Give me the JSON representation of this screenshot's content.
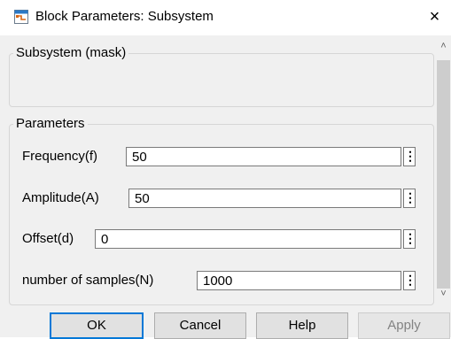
{
  "window": {
    "title": "Block Parameters: Subsystem",
    "icon": "simulink-block-icon",
    "close_label": "×"
  },
  "mask_group": {
    "legend": "Subsystem (mask)"
  },
  "parameters": {
    "legend": "Parameters",
    "rows": [
      {
        "label": "Frequency(f)",
        "value": "50"
      },
      {
        "label": "Amplitude(A)",
        "value": "50"
      },
      {
        "label": "Offset(d)",
        "value": "0"
      },
      {
        "label": "number of samples(N)",
        "value": "1000"
      }
    ],
    "dots_label": "⋮"
  },
  "scrollbar": {
    "up_arrow": "˄",
    "down_arrow": "˅"
  },
  "buttons": {
    "ok": "OK",
    "cancel": "Cancel",
    "help": "Help",
    "apply": "Apply"
  },
  "colors": {
    "focus_border": "#0078d7",
    "background": "#f0f0f0",
    "disabled_text": "#838383"
  }
}
